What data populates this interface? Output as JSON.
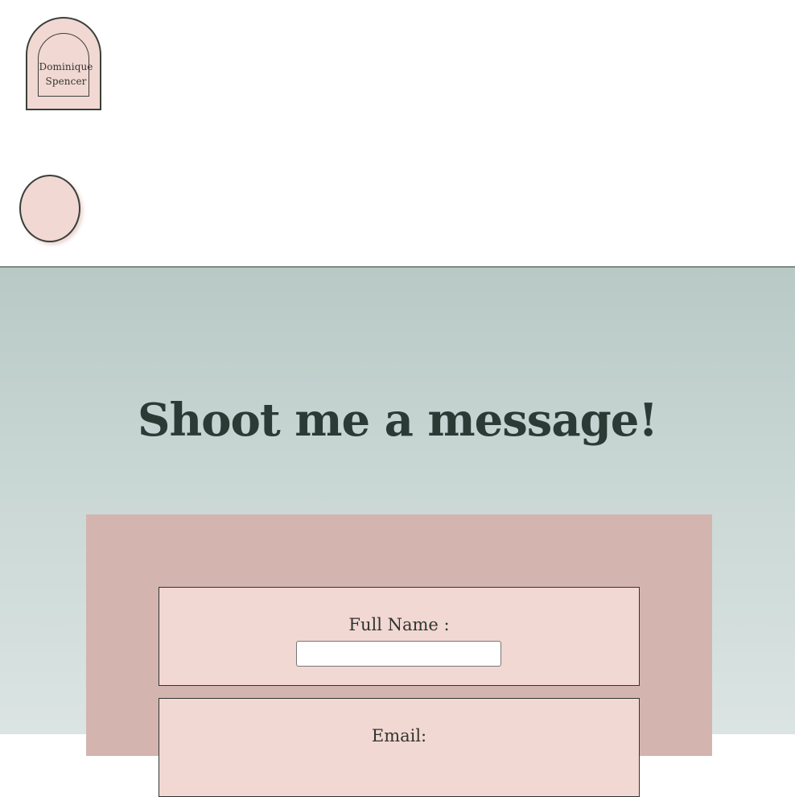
{
  "header": {
    "logo": {
      "line1": "Dominique",
      "line2": "Spencer"
    }
  },
  "contact": {
    "title": "Shoot me a message!",
    "fields": {
      "name": {
        "label": "Full Name :",
        "value": ""
      },
      "email": {
        "label": "Email:"
      }
    }
  },
  "colors": {
    "blush": "#f2d8d2",
    "dusty_rose": "#d4b4af",
    "sage": "#b8c9c6",
    "dark_green": "#2c3a35"
  }
}
